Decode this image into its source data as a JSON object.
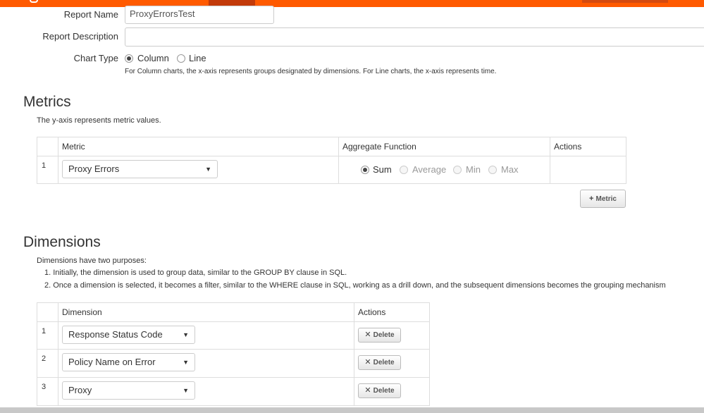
{
  "form": {
    "report_name_label": "Report Name",
    "report_name_value": "ProxyErrorsTest",
    "report_description_label": "Report Description",
    "report_description_value": "",
    "chart_type_label": "Chart Type",
    "chart_type_options": [
      "Column",
      "Line"
    ],
    "chart_type_selected": "Column",
    "chart_type_help": "For Column charts, the x-axis represents groups designated by dimensions. For Line charts, the x-axis represents time."
  },
  "metrics": {
    "title": "Metrics",
    "note": "The y-axis represents metric values.",
    "columns": [
      "Metric",
      "Aggregate Function",
      "Actions"
    ],
    "rows": [
      {
        "index": "1",
        "metric": "Proxy Errors",
        "aggregate_options": [
          "Sum",
          "Average",
          "Min",
          "Max"
        ],
        "aggregate_selected": "Sum"
      }
    ],
    "add_button_label": "Metric",
    "add_icon": "+"
  },
  "dimensions": {
    "title": "Dimensions",
    "intro": "Dimensions have two purposes:",
    "points": [
      "1. Initially, the dimension is used to group data, similar to the GROUP BY clause in SQL.",
      "2. Once a dimension is selected, it becomes a filter, similar to the WHERE clause in SQL, working as a drill down, and the subsequent dimensions becomes the grouping mechanism"
    ],
    "columns": [
      "Dimension",
      "Actions"
    ],
    "rows": [
      {
        "index": "1",
        "dimension": "Response Status Code",
        "delete_label": "Delete"
      },
      {
        "index": "2",
        "dimension": "Policy Name on Error",
        "delete_label": "Delete"
      },
      {
        "index": "3",
        "dimension": "Proxy",
        "delete_label": "Delete"
      }
    ],
    "delete_icon": "✕"
  },
  "icons": {
    "caret": "▼"
  },
  "colors": {
    "brand": "#ff5a00",
    "brand_dark": "#c23a0a"
  }
}
